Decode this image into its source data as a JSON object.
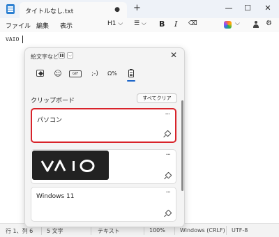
{
  "titlebar": {
    "tab_title": "タイトルなし.txt",
    "tab_modified": "●",
    "new_tab": "+",
    "minimize": "—",
    "maximize": "☐",
    "close": "✕"
  },
  "menu": {
    "items": [
      "ファイル",
      "編集",
      "表示"
    ],
    "heading": "H1 ⌵",
    "list": "☰ ⌵",
    "bold": "B",
    "italic": "I",
    "clear_format": "⌫",
    "copilot_chevron": "⌵",
    "settings": "⚙"
  },
  "editor": {
    "text": "VAIO"
  },
  "panel": {
    "title": "絵文字など",
    "close": "✕",
    "categories": {
      "emoji_icon": "heart-icon",
      "smile": "☺",
      "gif": "GIF",
      "kaomoji": ";-)",
      "symbols": "Ω%",
      "clipboard_icon": "clipboard-icon"
    },
    "section_title": "クリップボード",
    "clear_all": "すべてクリア",
    "items": [
      {
        "text": "パソコン",
        "more": "···"
      },
      {
        "image": "VAIO logo",
        "more": "···"
      },
      {
        "text": "Windows 11",
        "more": "···"
      }
    ]
  },
  "status": {
    "position": "行 1、列 6",
    "chars": "5 文字",
    "format": "テキスト",
    "zoom": "100%",
    "line_ending": "Windows (CRLF)",
    "encoding": "UTF-8"
  },
  "colors": {
    "selection_outline": "#d8232a",
    "accent": "#1a64c8"
  }
}
